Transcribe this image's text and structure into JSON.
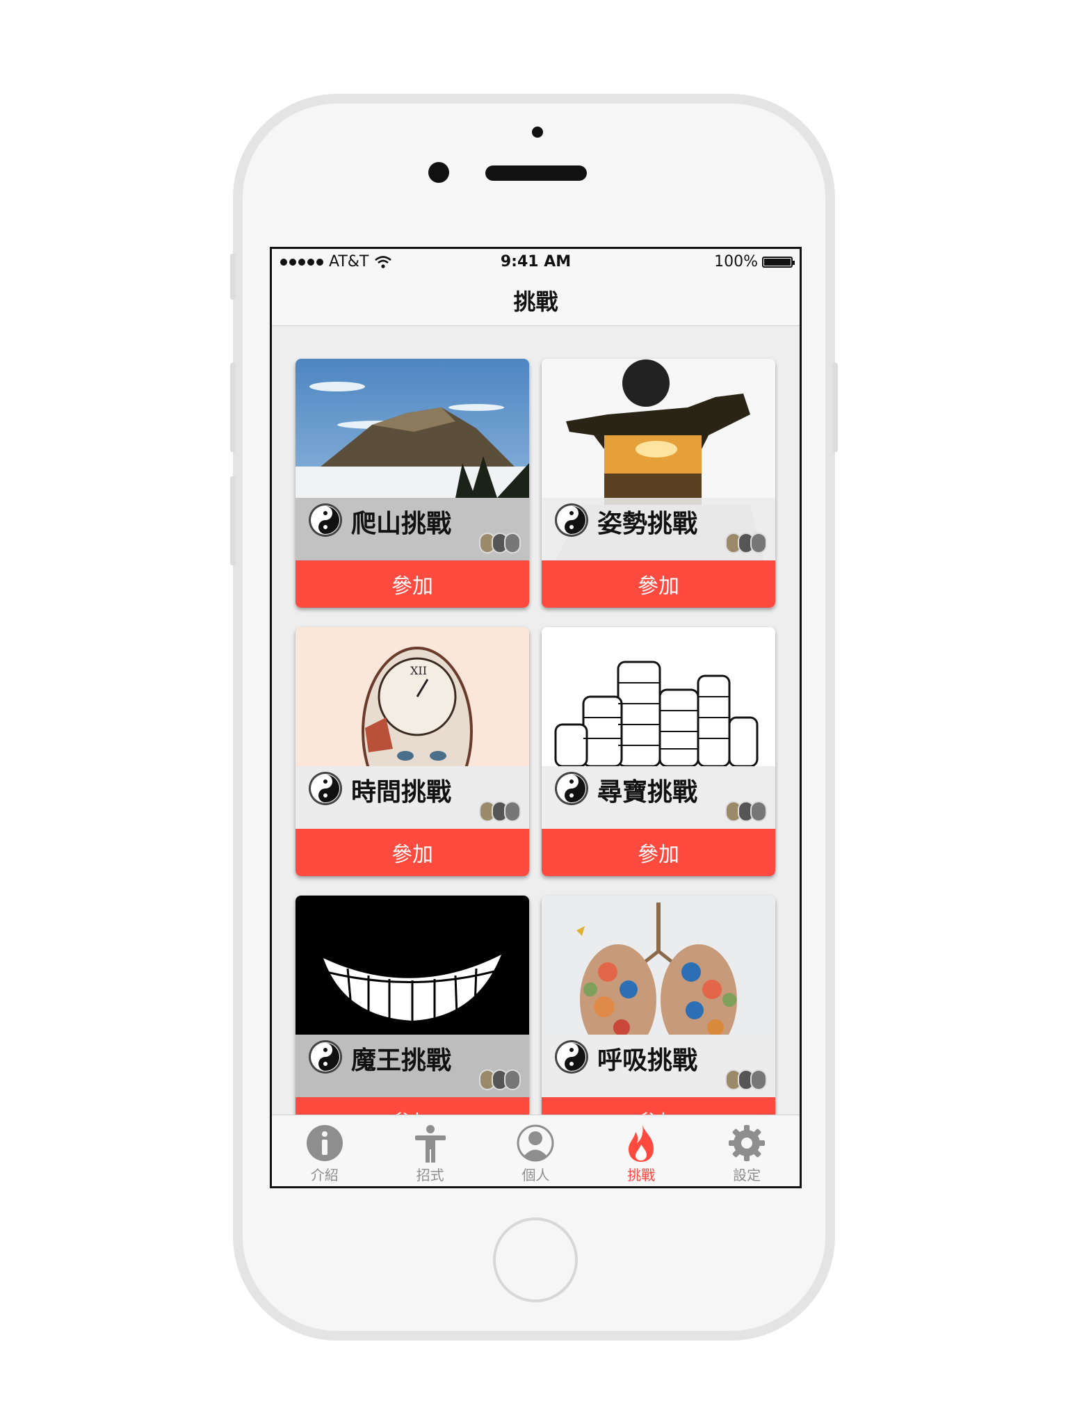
{
  "status_bar": {
    "carrier": "AT&T",
    "time": "9:41 AM",
    "battery": "100%"
  },
  "nav": {
    "title": "挑戰"
  },
  "cards": [
    {
      "title": "爬山挑戰",
      "button": "參加",
      "icon": "yin-yang-icon",
      "image": "mountain-photo"
    },
    {
      "title": "姿勢挑戰",
      "button": "參加",
      "icon": "yin-yang-icon",
      "image": "kung-fu-silhouette"
    },
    {
      "title": "時間挑戰",
      "button": "參加",
      "icon": "yin-yang-icon",
      "image": "clock-face-art"
    },
    {
      "title": "尋寶挑戰",
      "button": "參加",
      "icon": "yin-yang-icon",
      "image": "coin-stacks-drawing"
    },
    {
      "title": "魔王挑戰",
      "button": "參加",
      "icon": "yin-yang-icon",
      "image": "grin-teeth"
    },
    {
      "title": "呼吸挑戰",
      "button": "參加",
      "icon": "yin-yang-icon",
      "image": "flower-lungs"
    }
  ],
  "tabs": [
    {
      "label": "介紹",
      "icon": "info-icon",
      "active": false
    },
    {
      "label": "招式",
      "icon": "person-icon",
      "active": false
    },
    {
      "label": "個人",
      "icon": "profile-icon",
      "active": false
    },
    {
      "label": "挑戰",
      "icon": "flame-icon",
      "active": true
    },
    {
      "label": "設定",
      "icon": "gear-icon",
      "active": false
    }
  ],
  "colors": {
    "accent": "#ff4a40",
    "tab_inactive": "#8e8e8e"
  }
}
